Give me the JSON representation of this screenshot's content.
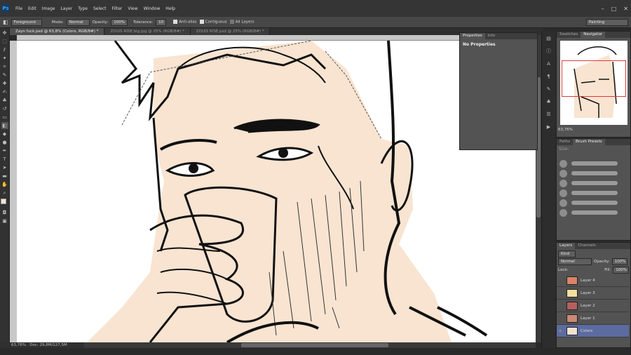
{
  "menubar": {
    "logo": "Ps",
    "items": [
      "File",
      "Edit",
      "Image",
      "Layer",
      "Type",
      "Select",
      "Filter",
      "View",
      "Window",
      "Help"
    ],
    "win_controls": [
      "–",
      "□",
      "✕"
    ]
  },
  "options": {
    "tool_preset": "Foreground",
    "mode_label": "Mode:",
    "mode_value": "Normal",
    "opacity_label": "Opacity:",
    "opacity_value": "100%",
    "tolerance_label": "Tolerance:",
    "tolerance_value": "10",
    "antialias": "Anti-alias",
    "contiguous": "Contiguous",
    "all_layers": "All Layers",
    "workspace": "Painting"
  },
  "tabs": [
    "Zayn fuck.psd @ 63,8% (Colors, RGB/8#) *",
    "ZOUIS RISE big.jpg @ 25% (RGB/8#) *",
    "ZOUIS RISE.psd @ 25% (RGB/8#) *"
  ],
  "status": {
    "zoom": "63,76%",
    "doc": "Doc: 29,8M/127,5M"
  },
  "properties": {
    "tab1": "Properties",
    "tab2": "Info",
    "title": "No Properties"
  },
  "navigator": {
    "tab1": "Swatches",
    "tab2": "Navigator",
    "zoom": "63,76%"
  },
  "brushes": {
    "tab1": "Paths",
    "tab2": "Brush Presets",
    "size_label": "Size:"
  },
  "layers": {
    "tab1": "Layers",
    "tab2": "Channels",
    "kind": "Kind",
    "blend": "Normal",
    "opacity_label": "Opacity:",
    "opacity_value": "100%",
    "lock_label": "Lock:",
    "fill_label": "Fill:",
    "fill_value": "100%",
    "rows": [
      {
        "name": "Layer 4",
        "color": "#d98468"
      },
      {
        "name": "Layer 3",
        "color": "#f3df9f"
      },
      {
        "name": "Layer 2",
        "color": "#b56060"
      },
      {
        "name": "Layer 1",
        "color": "#c98876"
      },
      {
        "name": "Colors",
        "color": "#f3e1d0"
      }
    ]
  },
  "colors": {
    "skin": "#f8e4d1",
    "accent": "#5c6ba0",
    "ui_dark": "#353535"
  }
}
